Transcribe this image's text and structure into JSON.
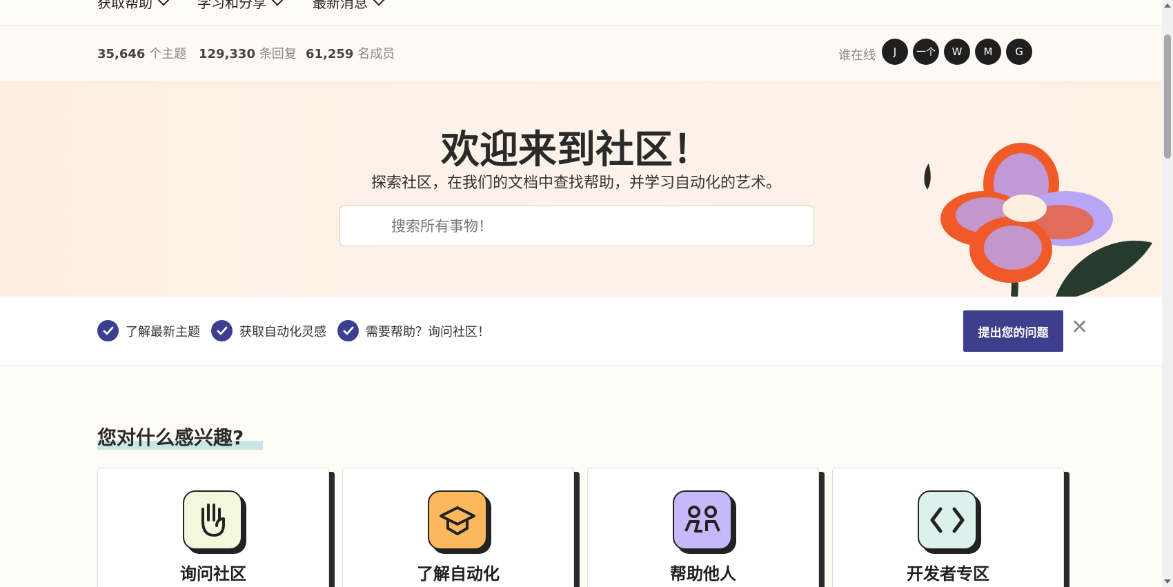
{
  "nav": {
    "items": [
      {
        "label": "获取帮助"
      },
      {
        "label": "学习和分享"
      },
      {
        "label": "最新消息"
      }
    ]
  },
  "stats": {
    "topics_count": "35,646",
    "topics_label": "个主题",
    "replies_count": "129,330",
    "replies_label": "条回复",
    "members_count": "61,259",
    "members_label": "名成员",
    "online_label": "谁在线",
    "online_users": [
      "J",
      "一个",
      "W",
      "M",
      "G"
    ]
  },
  "hero": {
    "title": "欢迎来到社区！",
    "subtitle": "探索社区，在我们的文档中查找帮助，并学习自动化的艺术。",
    "search_placeholder": "搜索所有事物！"
  },
  "checklist": {
    "items": [
      {
        "label": "了解最新主题"
      },
      {
        "label": "获取自动化灵感"
      },
      {
        "label": "需要帮助？询问社区！"
      }
    ],
    "ask_button": "提出您的问题",
    "close": "✕"
  },
  "interests": {
    "title": "您对什么感兴趣?",
    "cards": [
      {
        "title": "询问社区",
        "icon": "hand-icon",
        "color": "#f3f8dc"
      },
      {
        "title": "了解自动化",
        "icon": "graduation-cap-icon",
        "color": "#fbb85c"
      },
      {
        "title": "帮助他人",
        "icon": "people-icon",
        "color": "#c6b8fb"
      },
      {
        "title": "开发者专区",
        "icon": "code-brackets-icon",
        "color": "#dcf1ec"
      }
    ]
  },
  "colors": {
    "accent": "#3d3f8c",
    "hero_bg": "#fdeee2",
    "highlight": "#c8e6e3"
  }
}
